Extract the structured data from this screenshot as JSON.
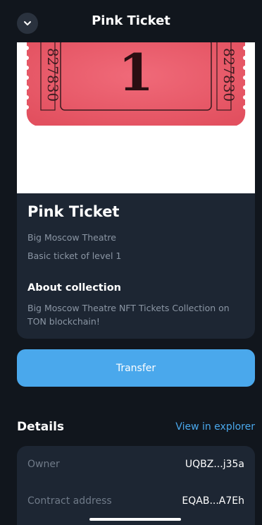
{
  "header": {
    "title": "Pink Ticket"
  },
  "nft": {
    "name": "Pink Ticket",
    "collection": "Big Moscow Theatre",
    "description": "Basic ticket of level 1",
    "image": {
      "ticket_number": "1",
      "serial": "827830",
      "ticket_color": "#ec5a6a"
    }
  },
  "about": {
    "title": "About collection",
    "text": "Big Moscow Theatre NFT Tickets Collection on TON blockchain!"
  },
  "actions": {
    "transfer_label": "Transfer"
  },
  "details": {
    "title": "Details",
    "explorer_link": "View in explorer",
    "rows": [
      {
        "label": "Owner",
        "value": "UQBZ...j35a"
      },
      {
        "label": "Contract address",
        "value": "EQAB...A7Eh"
      }
    ]
  },
  "colors": {
    "background": "#11161d",
    "card": "#1d2633",
    "accent": "#4aa8ec",
    "muted_text": "#8b96a4"
  }
}
